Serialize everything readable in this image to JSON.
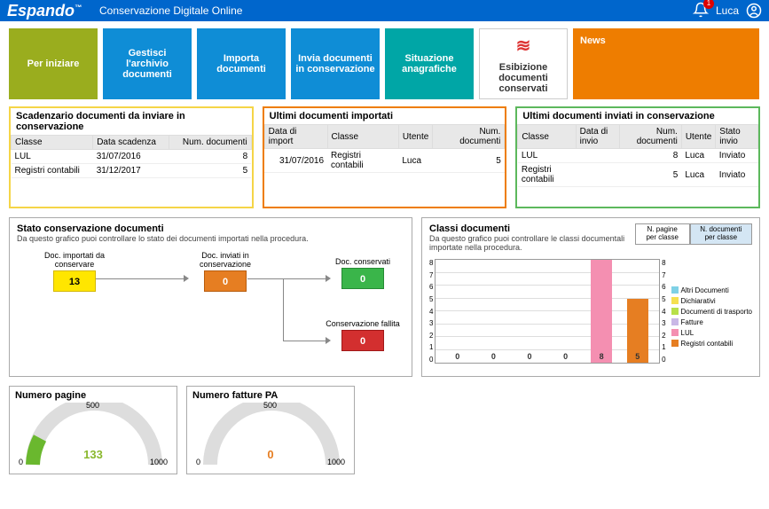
{
  "header": {
    "brand": "Espando",
    "subtitle": "Conservazione Digitale Online",
    "notif_count": "1",
    "user": "Luca"
  },
  "nav": {
    "per_iniziare": "Per iniziare",
    "gestisci": "Gestisci l'archivio documenti",
    "importa": "Importa documenti",
    "invia": "Invia documenti in conservazione",
    "situazione": "Situazione anagrafiche",
    "esibizione": "Esibizione documenti conservati",
    "news": "News"
  },
  "panel_scad": {
    "title": "Scadenzario documenti da inviare in conservazione",
    "cols": {
      "classe": "Classe",
      "data": "Data scadenza",
      "num": "Num. documenti"
    },
    "rows": [
      {
        "classe": "LUL",
        "data": "31/07/2016",
        "num": "8"
      },
      {
        "classe": "Registri contabili",
        "data": "31/12/2017",
        "num": "5"
      }
    ]
  },
  "panel_import": {
    "title": "Ultimi documenti importati",
    "cols": {
      "data": "Data di import",
      "classe": "Classe",
      "utente": "Utente",
      "num": "Num. documenti"
    },
    "rows": [
      {
        "data": "31/07/2016",
        "classe": "Registri contabili",
        "utente": "Luca",
        "num": "5"
      }
    ]
  },
  "panel_inviati": {
    "title": "Ultimi documenti inviati in conservazione",
    "cols": {
      "classe": "Classe",
      "data": "Data di invio",
      "num": "Num. documenti",
      "utente": "Utente",
      "stato": "Stato invio"
    },
    "rows": [
      {
        "classe": "LUL",
        "data": "",
        "num": "8",
        "utente": "Luca",
        "stato": "Inviato"
      },
      {
        "classe": "Registri contabili",
        "data": "",
        "num": "5",
        "utente": "Luca",
        "stato": "Inviato"
      }
    ]
  },
  "flow_chart": {
    "title": "Stato conservazione documenti",
    "sub": "Da questo grafico puoi controllare lo stato dei documenti importati nella procedura.",
    "boxes": {
      "importati": {
        "label": "Doc. importati da conservare",
        "value": "13"
      },
      "inviati": {
        "label": "Doc. inviati in conservazione",
        "value": "0"
      },
      "conservati": {
        "label": "Doc. conservati",
        "value": "0"
      },
      "fallita": {
        "label": "Conservazione fallita",
        "value": "0"
      }
    }
  },
  "bar_chart": {
    "title": "Classi documenti",
    "sub": "Da questo grafico puoi controllare le classi documentali importate nella procedura.",
    "btn_pagine": "N. pagine per classe",
    "btn_doc": "N. documenti per classe",
    "legend": {
      "altri": "Altri Documenti",
      "dich": "Dichiarativi",
      "trasp": "Documenti di trasporto",
      "fatture": "Fatture",
      "lul": "LUL",
      "registri": "Registri contabili"
    }
  },
  "chart_data": [
    {
      "type": "bar",
      "title": "Classi documenti",
      "ylabel": "N. documenti",
      "ylim": [
        0,
        8
      ],
      "categories": [
        "Altri Documenti",
        "Dichiarativi",
        "Documenti di trasporto",
        "Fatture",
        "LUL",
        "Registri contabili"
      ],
      "values": [
        0,
        0,
        0,
        0,
        8,
        5
      ],
      "colors": [
        "#7fd1e6",
        "#f5e050",
        "#b8e04a",
        "#c9b8e6",
        "#f48fb1",
        "#e67e22"
      ]
    },
    {
      "type": "gauge",
      "title": "Numero pagine",
      "value": 133,
      "min": 0,
      "max": 1000,
      "mid": 500
    },
    {
      "type": "gauge",
      "title": "Numero fatture PA",
      "value": 0,
      "min": 0,
      "max": 1000,
      "mid": 500
    }
  ],
  "gauge_pagine": {
    "title": "Numero pagine",
    "min": "0",
    "mid": "500",
    "max": "1000",
    "value": "133"
  },
  "gauge_fatture": {
    "title": "Numero fatture PA",
    "min": "0",
    "mid": "500",
    "max": "1000",
    "value": "0"
  }
}
